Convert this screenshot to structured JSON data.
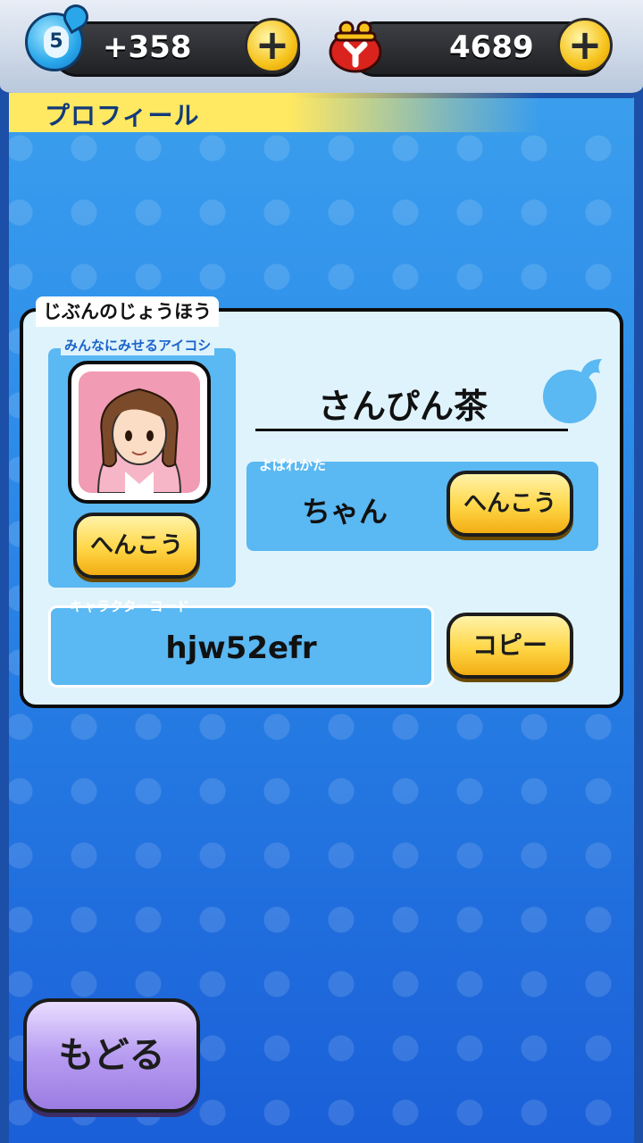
{
  "header": {
    "spirit_level": "5",
    "spirit_points": "+358",
    "money": "4689",
    "add_symbol": "+"
  },
  "page_title": "プロフィール",
  "profile": {
    "section_label": "じぶんのじょうほう",
    "icon_label": "みんなにみせるアイコシ",
    "icon_change_button": "へんこう",
    "player_name": "さんぴん茶",
    "title_label": "よばれかた",
    "title_value": "ちゃん",
    "title_change_button": "へんこう",
    "code_label": "キャラクターコード",
    "code_value": "hjw52efr",
    "copy_button": "コピー"
  },
  "back_button": "もどる",
  "colors": {
    "accent_yellow": "#ffd646",
    "panel_blue": "#5ab8f2",
    "back_purple": "#b79cf1",
    "purse_red": "#d9231c"
  }
}
